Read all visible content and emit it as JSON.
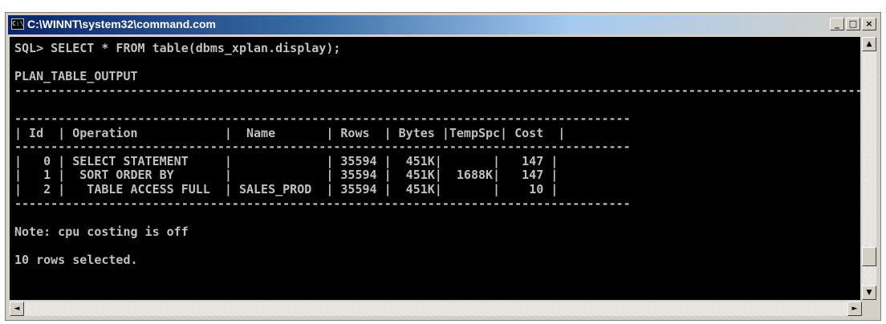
{
  "window": {
    "title": "C:\\WINNT\\system32\\command.com",
    "icon_name": "console-window-icon",
    "controls": {
      "minimize": "_",
      "maximize": "□",
      "close": "×"
    }
  },
  "console": {
    "lines": [
      "SQL> SELECT * FROM table(dbms_xplan.display);",
      "",
      "PLAN_TABLE_OUTPUT",
      "--------------------------------------------------------------------------------------------------------------------------------------------------------------------------------",
      "",
      "-------------------------------------------------------------------------------------",
      "| Id  | Operation            |  Name       | Rows  | Bytes |TempSpc| Cost  |",
      "-------------------------------------------------------------------------------------",
      "|   0 | SELECT STATEMENT     |             | 35594 |  451K|       |   147 |",
      "|   1 |  SORT ORDER BY       |             | 35594 |  451K|  1688K|   147 |",
      "|   2 |   TABLE ACCESS FULL  | SALES_PROD  | 35594 |  451K|       |    10 |",
      "-------------------------------------------------------------------------------------",
      "",
      "Note: cpu costing is off",
      "",
      "10 rows selected."
    ]
  },
  "scrollbar": {
    "up": "▲",
    "down": "▼",
    "left": "◄",
    "right": "►"
  }
}
